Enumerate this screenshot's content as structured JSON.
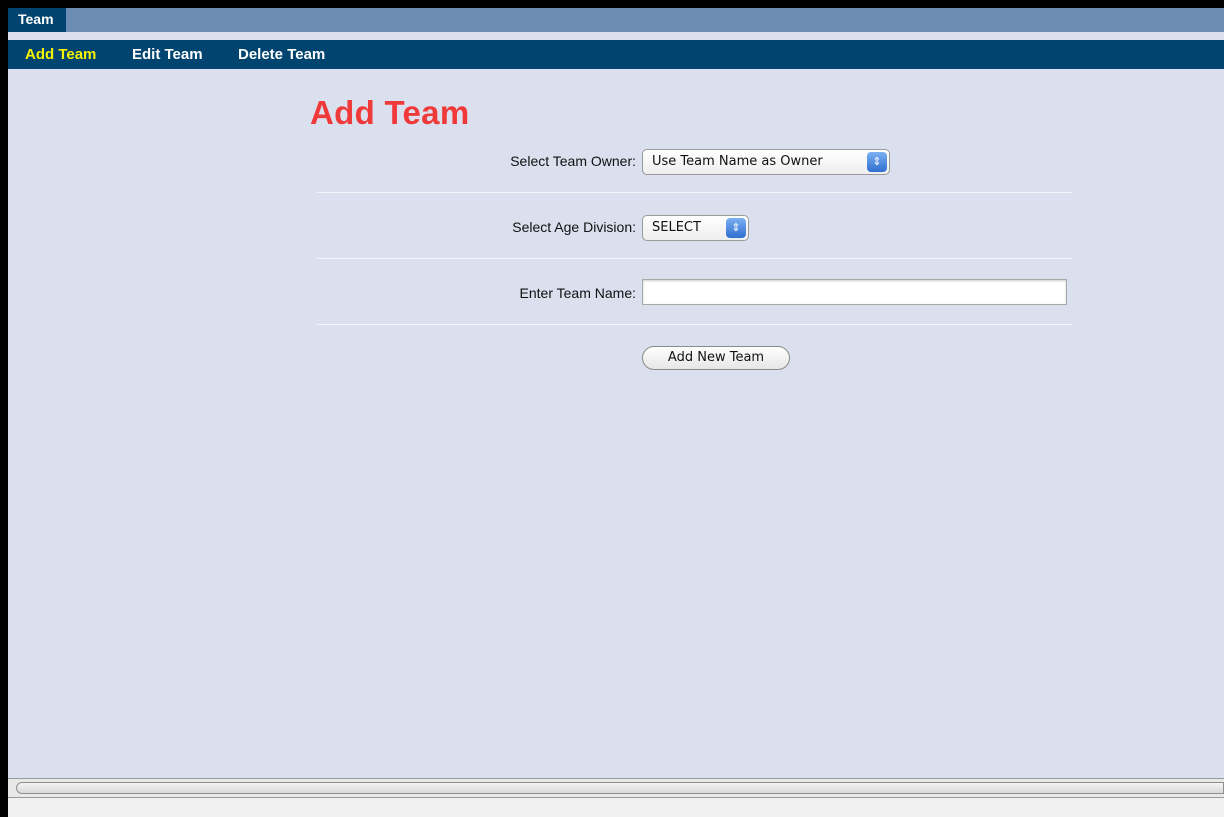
{
  "tabs": [
    {
      "label": "Team"
    }
  ],
  "subnav": {
    "add_label": "Add Team",
    "edit_label": "Edit Team",
    "delete_label": "Delete Team"
  },
  "page": {
    "title": "Add Team"
  },
  "form": {
    "owner_label": "Select Team Owner:",
    "owner_value": "Use Team Name as Owner",
    "age_label": "Select Age Division:",
    "age_value": "SELECT",
    "name_label": "Enter Team Name:",
    "name_value": "",
    "submit_label": "Add New Team"
  },
  "icons": {
    "select_arrow": "updown-chevron-icon"
  },
  "colors": {
    "nav_bg": "#00446f",
    "tabbar_bg": "#6b8db3",
    "active_nav": "#f5f200",
    "title": "#f03a3a",
    "content_bg": "#dbe0ee"
  }
}
